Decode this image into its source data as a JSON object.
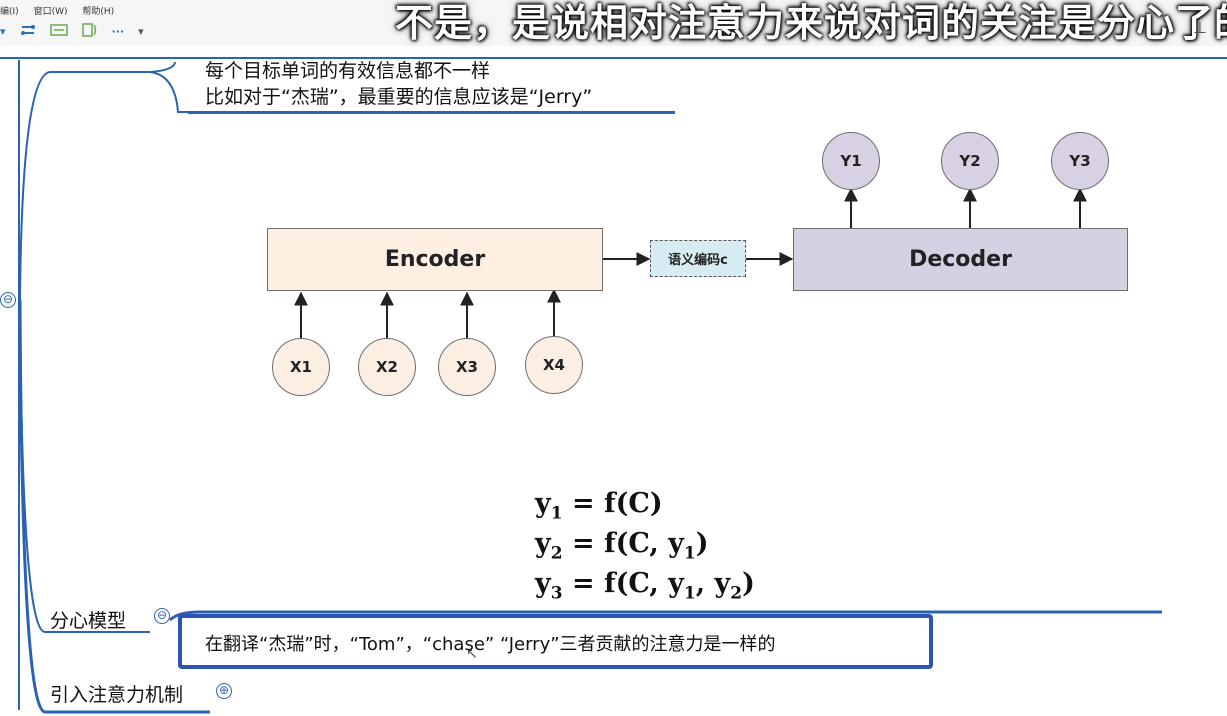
{
  "menu": {
    "items": [
      "编(I)",
      "窗口(W)",
      "帮助(H)"
    ]
  },
  "toolbar": {
    "more": "···",
    "dropdown": "▾"
  },
  "subtitle": "不是，是说相对注意力来说对词的关注是分心了的",
  "nodes": {
    "top_line1": "每个目标单词的有效信息都不一样",
    "top_line2": "比如对于“杰瑞”，最重要的信息应该是“Jerry”",
    "distract": "分心模型",
    "distract_detail": "在翻译“杰瑞”时，“Tom”，“chase” “Jerry”三者贡献的注意力是一样的",
    "introduce": "引入注意力机制",
    "collapse_sign": "⊖",
    "expand_sign": "⊕"
  },
  "diagram": {
    "encoder": "Encoder",
    "decoder": "Decoder",
    "semantic_code": "语义编码c",
    "inputs": [
      "X1",
      "X2",
      "X3",
      "X4"
    ],
    "outputs": [
      "Y1",
      "Y2",
      "Y3"
    ],
    "colors": {
      "encoder": "#fdf0e3",
      "decoder": "#d6d0e3",
      "input": "#fbeee2",
      "output": "#d8d1e4",
      "semantic": "#d7ecf2"
    }
  },
  "formulas": [
    {
      "lhs": "y",
      "sub": "1",
      "rhs": "= f(C)"
    },
    {
      "lhs": "y",
      "sub": "2",
      "rhs_pre": "= f(C, y",
      "rhs_sub1": "1",
      "rhs_post": ")"
    },
    {
      "lhs": "y",
      "sub": "3",
      "rhs_pre": "= f(C, y",
      "rhs_sub1": "1",
      "rhs_mid": ", y",
      "rhs_sub2": "2",
      "rhs_post": ")"
    }
  ],
  "colors": {
    "accent": "#2c63b0",
    "focus_border": "#2d54b5"
  }
}
